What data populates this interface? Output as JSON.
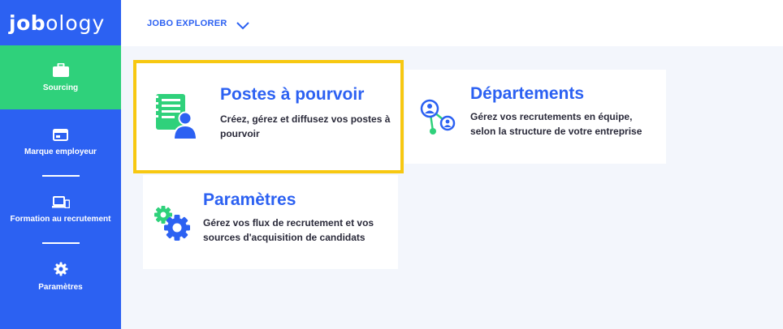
{
  "app": {
    "logo_bold": "job",
    "logo_light": "ology"
  },
  "sidebar": {
    "items": [
      {
        "label": "Sourcing",
        "icon": "briefcase-icon",
        "active": true
      },
      {
        "label": "Marque employeur",
        "icon": "window-icon",
        "active": false
      },
      {
        "label": "Formation au recrutement",
        "icon": "devices-icon",
        "active": false
      },
      {
        "label": "Paramètres",
        "icon": "gear-icon",
        "active": false
      }
    ]
  },
  "header": {
    "title": "JOBO EXPLORER",
    "dropdown_icon": "chevron-down-icon"
  },
  "cards": [
    {
      "title": "Postes à pourvoir",
      "description": "Créez, gérez et diffusez vos postes à pourvoir",
      "icon": "job-posting-icon",
      "highlighted": true
    },
    {
      "title": "Départements",
      "description": "Gérez vos recrutements en équipe, selon la structure de votre entreprise",
      "icon": "team-network-icon",
      "highlighted": false
    },
    {
      "title": "Paramètres",
      "description": "Gérez vos flux de recrutement et vos sources d'acquisition de candidats",
      "icon": "gears-icon",
      "highlighted": false
    }
  ],
  "colors": {
    "primary": "#2c61f2",
    "active": "#2fd17b",
    "highlight": "#f7c811",
    "background": "#f3f6fc"
  }
}
